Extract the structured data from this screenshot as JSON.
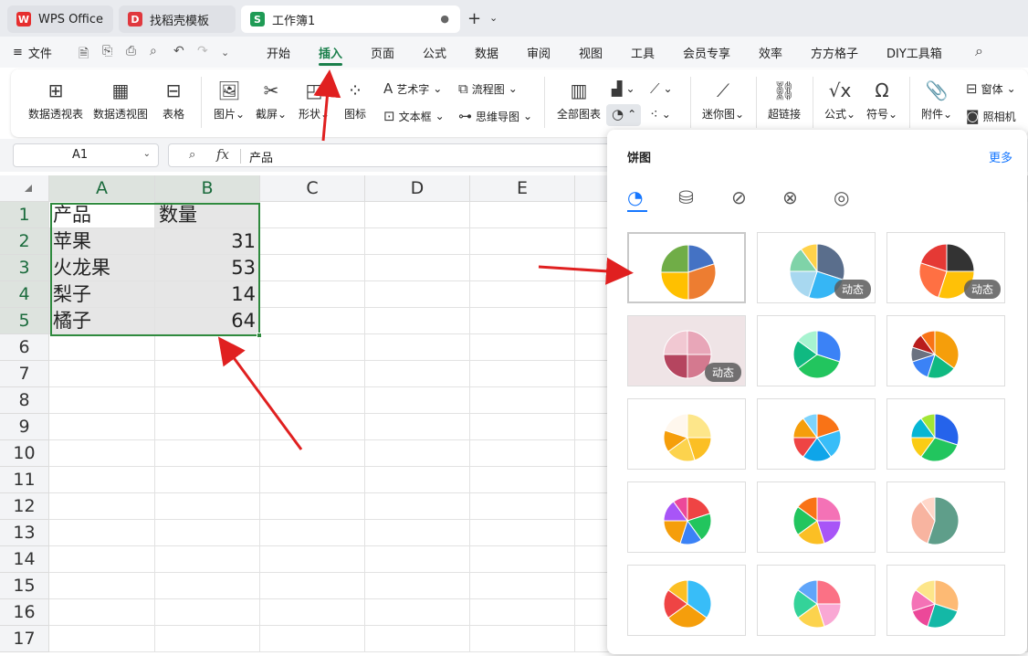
{
  "tabs": [
    {
      "label": "WPS Office",
      "logo": "W"
    },
    {
      "label": "找稻壳模板",
      "logo": "D"
    },
    {
      "label": "工作簿1",
      "logo": "S"
    }
  ],
  "menu": {
    "file": "文件",
    "items": [
      "开始",
      "插入",
      "页面",
      "公式",
      "数据",
      "审阅",
      "视图",
      "工具",
      "会员专享",
      "效率",
      "方方格子",
      "DIY工具箱"
    ]
  },
  "ribbon": {
    "pivot_table": "数据透视表",
    "pivot_chart": "数据透视图",
    "table": "表格",
    "picture": "图片",
    "screenshot": "截屏",
    "shape": "形状",
    "icon": "图标",
    "wordart": "艺术字",
    "textbox": "文本框",
    "flowchart": "流程图",
    "mindmap": "思维导图",
    "all_charts": "全部图表",
    "sparkline": "迷你图",
    "hyperlink": "超链接",
    "formula": "公式",
    "symbol": "符号",
    "attachment": "附件",
    "form": "窗体",
    "camera": "照相机"
  },
  "formula_bar": {
    "cell_ref": "A1",
    "content": "产品",
    "fx": "fx"
  },
  "sheet": {
    "columns": [
      "A",
      "B",
      "C",
      "D",
      "E"
    ],
    "rows": [
      "1",
      "2",
      "3",
      "4",
      "5",
      "6",
      "7",
      "8",
      "9",
      "10",
      "11",
      "12",
      "13",
      "14",
      "15",
      "16",
      "17"
    ],
    "header": [
      "产品",
      "数量"
    ],
    "data": [
      [
        "苹果",
        "31"
      ],
      [
        "火龙果",
        "53"
      ],
      [
        "梨子",
        "14"
      ],
      [
        "橘子",
        "64"
      ]
    ]
  },
  "panel": {
    "title": "饼图",
    "more": "更多",
    "dynamic_label": "动态",
    "subtypes": [
      "pie-icon",
      "3d-pie-icon",
      "pie-of-pie-icon",
      "bar-of-pie-icon",
      "doughnut-icon"
    ]
  },
  "colors": {
    "accent_green": "#1a7f4b",
    "selection_green": "#2f8a3e",
    "link_blue": "#1677ff",
    "arrow_red": "#e02020"
  }
}
